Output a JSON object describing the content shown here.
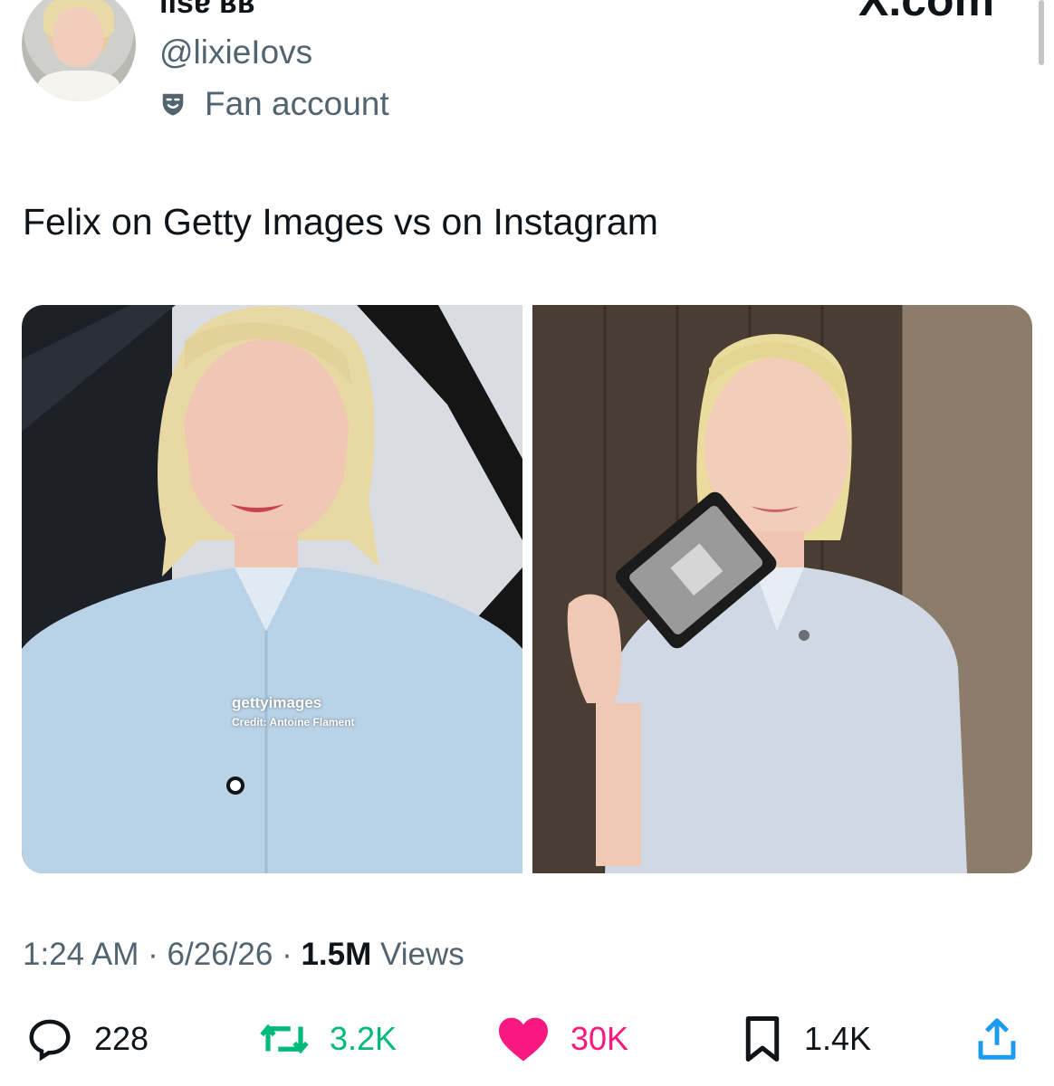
{
  "header": {
    "display_name": "ıısɐ ʁʁ",
    "handle": "@lixieIovs",
    "badge_label": "Fan account",
    "badge_icon": "theater-mask-icon",
    "site_label": "X.com"
  },
  "tweet": {
    "text": "Felix on Getty Images vs on Instagram",
    "media": {
      "left_watermark_brand": "gettyimages",
      "left_watermark_credit": "Credit: Antoine Flament"
    },
    "meta": {
      "time": "1:24 AM",
      "date": "6/26/26",
      "views_count": "1.5M",
      "views_label": "Views",
      "separator": "·"
    }
  },
  "actions": {
    "reply": {
      "icon": "reply-icon",
      "count": "228",
      "color": "#0f1419"
    },
    "repost": {
      "icon": "repost-icon",
      "count": "3.2K",
      "color": "#00ba7c"
    },
    "like": {
      "icon": "heart-icon",
      "count": "30K",
      "color": "#f91880"
    },
    "bookmark": {
      "icon": "bookmark-icon",
      "count": "1.4K",
      "color": "#0f1419"
    },
    "share": {
      "icon": "share-icon"
    }
  },
  "colors": {
    "secondary_text": "#536471",
    "primary_text": "#0f1419",
    "accent_like": "#f91880",
    "accent_repost": "#00ba7c",
    "share_blue": "#1d9bf0"
  }
}
